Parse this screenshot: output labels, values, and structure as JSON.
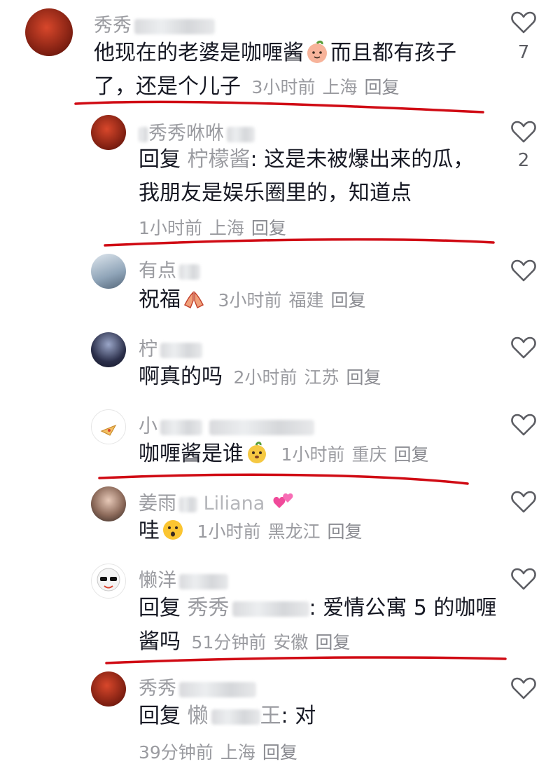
{
  "comments": [
    {
      "username": "秀秀",
      "text1": "他现在的老婆是咖喱酱",
      "text2": "而且都有孩子",
      "text3": "了，还是个儿子",
      "time": "3小时前",
      "location": "上海",
      "reply": "回复",
      "likes": "7"
    },
    {
      "username": "秀秀咻咻",
      "reply_prefix": "回复",
      "reply_to": "柠檬酱",
      "text1": ": 这是未被爆出来的瓜，",
      "text2": "我朋友是娱乐圈里的，知道点",
      "time": "1小时前",
      "location": "上海",
      "reply": "回复",
      "likes": "2"
    },
    {
      "username": "有点",
      "text": "祝福",
      "time": "3小时前",
      "location": "福建",
      "reply": "回复"
    },
    {
      "username": "柠",
      "text": "啊真的吗",
      "time": "2小时前",
      "location": "江苏",
      "reply": "回复"
    },
    {
      "username": "小",
      "text": "咖喱酱是谁",
      "time": "1小时前",
      "location": "重庆",
      "reply": "回复"
    },
    {
      "username": "姜雨",
      "username_suffix": "Liliana",
      "text": "哇",
      "time": "1小时前",
      "location": "黑龙江",
      "reply": "回复"
    },
    {
      "username": "懒洋",
      "reply_prefix": "回复",
      "reply_to": "秀秀",
      "text1": ": 爱情公寓 5 的咖喱",
      "text2": "酱吗",
      "time": "51分钟前",
      "location": "安徽",
      "reply": "回复"
    },
    {
      "username": "秀秀",
      "reply_prefix": "回复",
      "reply_to": "懒",
      "reply_to_tail": "王",
      "text1": ": 对",
      "time": "39分钟前",
      "location": "上海",
      "reply": "回复"
    }
  ],
  "icons": {
    "like": "heart-outline-icon",
    "emoji_peach": "peach-face-emoji",
    "emoji_pray": "praying-hands-emoji",
    "emoji_dog": "dog-face-emoji",
    "emoji_hush": "hushed-face-emoji",
    "emoji_hearts": "two-hearts-emoji"
  },
  "colors": {
    "annotation_line": "#d00b14",
    "meta_gray": "#9a9ba0",
    "text": "#161823"
  }
}
